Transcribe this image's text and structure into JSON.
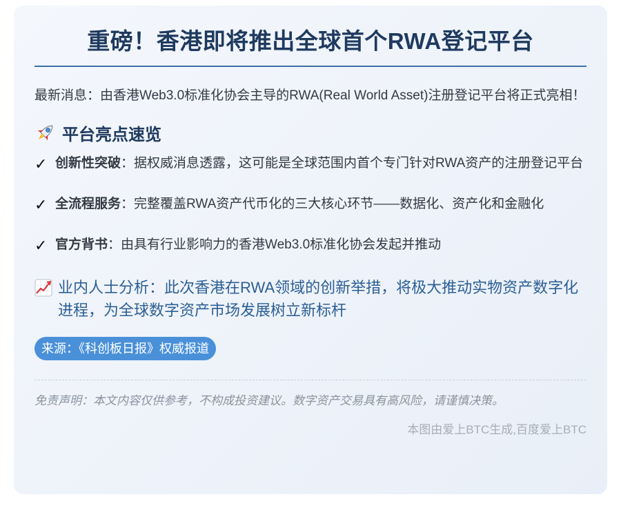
{
  "title": "重磅！香港即将推出全球首个RWA登记平台",
  "intro": "最新消息：由香港Web3.0标准化协会主导的RWA(Real World Asset)注册登记平台将正式亮相！",
  "highlights_section": {
    "icon": "rocket-icon",
    "heading": "平台亮点速览",
    "items": [
      {
        "title": "创新性突破",
        "text": "：据权威消息透露，这可能是全球范围内首个专门针对RWA资产的注册登记平台"
      },
      {
        "title": "全流程服务",
        "text": "：完整覆盖RWA资产代币化的三大核心环节——数据化、资产化和金融化"
      },
      {
        "title": "官方背书",
        "text": "：由具有行业影响力的香港Web3.0标准化协会发起并推动"
      }
    ]
  },
  "analysis": {
    "icon": "chart-increasing-icon",
    "text": "业内人士分析：此次香港在RWA领域的创新举措，将极大推动实物资产数字化进程，为全球数字资产市场发展树立新标杆"
  },
  "source": "来源：《科创板日报》权威报道",
  "disclaimer": "免责声明：本文内容仅供参考，不构成投资建议。数字资产交易具有高风险，请谨慎决策。",
  "footer_credit": "本图由爱上BTC生成,百度爱上BTC",
  "colors": {
    "title": "#1f3a5f",
    "accent_rule": "#3e6fa8",
    "analysis_text": "#2c5f94",
    "badge": "#4a90d9",
    "body_text": "#333a44",
    "muted": "#8a939f"
  }
}
